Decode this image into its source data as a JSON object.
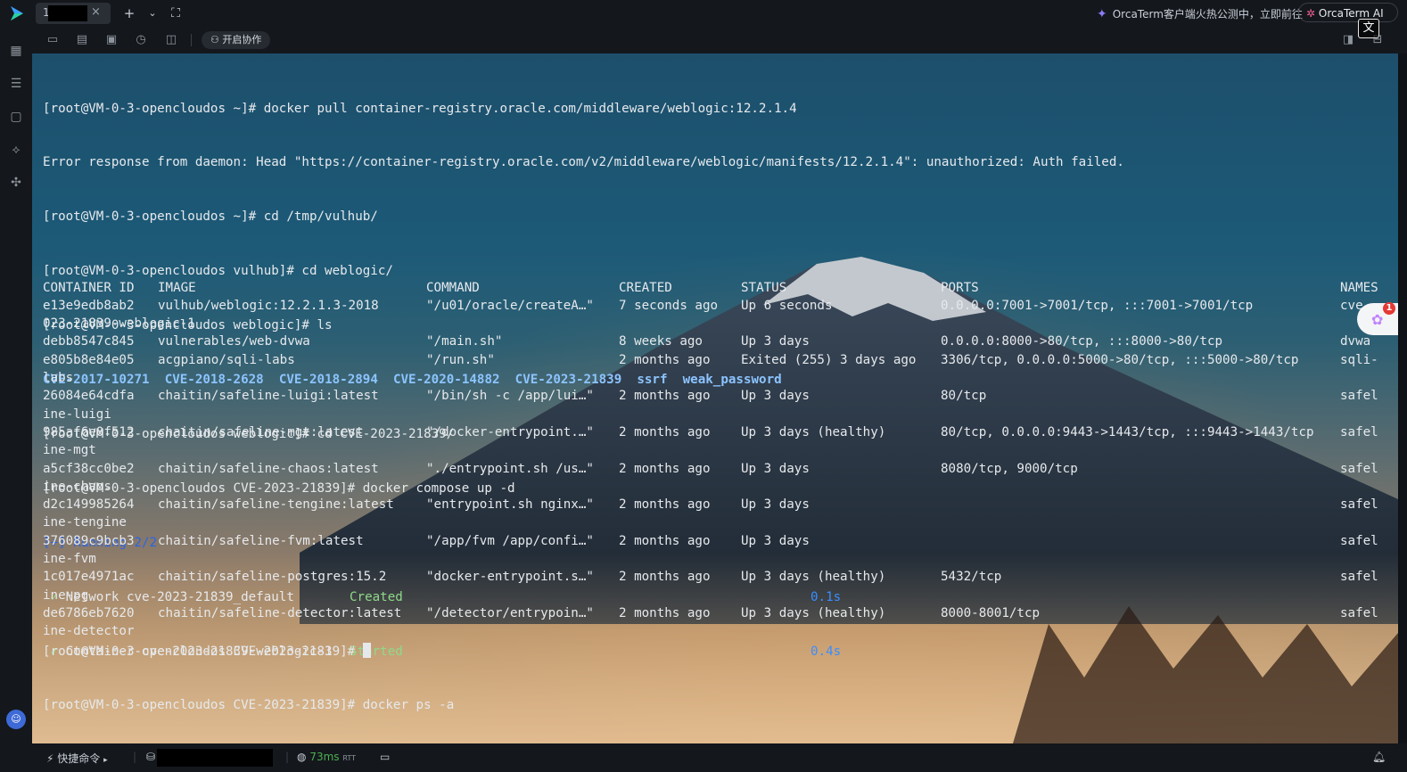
{
  "titlebar": {
    "tab_number": "1",
    "new_tab_symbol": "+",
    "promo_text": "OrcaTerm客户端火热公测中，立即前往",
    "ai_label": "OrcaTerm AI",
    "translate_symbol": "文"
  },
  "toolbar": {
    "collab_label": "开启协作"
  },
  "terminal": {
    "lines": [
      {
        "text": "[root@VM-0-3-opencloudos ~]# docker pull container-registry.oracle.com/middleware/weblogic:12.2.1.4"
      },
      {
        "text": "Error response from daemon: Head \"https://container-registry.oracle.com/v2/middleware/weblogic/manifests/12.2.1.4\": unauthorized: Auth failed."
      },
      {
        "text": "[root@VM-0-3-opencloudos ~]# cd /tmp/vulhub/"
      },
      {
        "text": "[root@VM-0-3-opencloudos vulhub]# cd weblogic/"
      },
      {
        "text": "[root@VM-0-3-opencloudos weblogic]# ls"
      }
    ],
    "ls_entries": [
      "CVE-2017-10271",
      "CVE-2018-2628",
      "CVE-2018-2894",
      "CVE-2020-14882",
      "CVE-2023-21839",
      "ssrf",
      "weak_password"
    ],
    "lines2": [
      {
        "text": "[root@VM-0-3-opencloudos weblogic]# cd CVE-2023-21839/"
      },
      {
        "text": "[root@VM-0-3-opencloudos CVE-2023-21839]# docker compose up -d"
      }
    ],
    "running_text": "[+] Running 2/2",
    "compose_items": [
      {
        "check": "✓",
        "name": "Network cve-2023-21839_default",
        "state": "Created",
        "time": "0.1s"
      },
      {
        "check": "✓",
        "name": "Container cve-2023-21839-weblogic-1",
        "state": "Started",
        "time": "0.4s"
      }
    ],
    "ps_command": "[root@VM-0-3-opencloudos CVE-2023-21839]# docker ps -a",
    "table_headers": [
      "CONTAINER ID",
      "IMAGE",
      "COMMAND",
      "CREATED",
      "STATUS",
      "PORTS",
      "NAMES"
    ],
    "rows": [
      {
        "id": "e13e9edb8ab2",
        "image": "vulhub/weblogic:12.2.1.3-2018",
        "command": "\"/u01/oracle/createA…\"",
        "created": "7 seconds ago",
        "status": "Up 6 seconds",
        "ports": "0.0.0.0:7001->7001/tcp, :::7001->7001/tcp",
        "name": "cve",
        "wrap": "023-21839-weblogic-1"
      },
      {
        "id": "debb8547c845",
        "image": "vulnerables/web-dvwa",
        "command": "\"/main.sh\"",
        "created": "8 weeks ago",
        "status": "Up 3 days",
        "ports": "0.0.0.0:8000->80/tcp, :::8000->80/tcp",
        "name": "dvwa",
        "wrap": ""
      },
      {
        "id": "e805b8e84e05",
        "image": "acgpiano/sqli-labs",
        "command": "\"/run.sh\"",
        "created": "2 months ago",
        "status": "Exited (255) 3 days ago",
        "ports": "3306/tcp, 0.0.0.0:5000->80/tcp, :::5000->80/tcp",
        "name": "sqli-",
        "wrap": "labs"
      },
      {
        "id": "26084e64cdfa",
        "image": "chaitin/safeline-luigi:latest",
        "command": "\"/bin/sh -c /app/lui…\"",
        "created": "2 months ago",
        "status": "Up 3 days",
        "ports": "80/tcp",
        "name": "safel",
        "wrap": "ine-luigi"
      },
      {
        "id": "985af6e0f512",
        "image": "chaitin/safeline-mgt:latest",
        "command": "\"/docker-entrypoint.…\"",
        "created": "2 months ago",
        "status": "Up 3 days (healthy)",
        "ports": "80/tcp, 0.0.0.0:9443->1443/tcp, :::9443->1443/tcp",
        "name": "safel",
        "wrap": "ine-mgt"
      },
      {
        "id": "a5cf38cc0be2",
        "image": "chaitin/safeline-chaos:latest",
        "command": "\"./entrypoint.sh /us…\"",
        "created": "2 months ago",
        "status": "Up 3 days",
        "ports": "8080/tcp, 9000/tcp",
        "name": "safel",
        "wrap": "ine-chaos"
      },
      {
        "id": "d2c149985264",
        "image": "chaitin/safeline-tengine:latest",
        "command": "\"entrypoint.sh nginx…\"",
        "created": "2 months ago",
        "status": "Up 3 days",
        "ports": "",
        "name": "safel",
        "wrap": "ine-tengine"
      },
      {
        "id": "376089c9bcb3",
        "image": "chaitin/safeline-fvm:latest",
        "command": "\"/app/fvm /app/confi…\"",
        "created": "2 months ago",
        "status": "Up 3 days",
        "ports": "",
        "name": "safel",
        "wrap": "ine-fvm"
      },
      {
        "id": "1c017e4971ac",
        "image": "chaitin/safeline-postgres:15.2",
        "command": "\"docker-entrypoint.s…\"",
        "created": "2 months ago",
        "status": "Up 3 days (healthy)",
        "ports": "5432/tcp",
        "name": "safel",
        "wrap": "ine-pg"
      },
      {
        "id": "de6786eb7620",
        "image": "chaitin/safeline-detector:latest",
        "command": "\"/detector/entrypoin…\"",
        "created": "2 months ago",
        "status": "Up 3 days (healthy)",
        "ports": "8000-8001/tcp",
        "name": "safel",
        "wrap": "ine-detector"
      }
    ],
    "prompt": "[root@VM-0-3-opencloudos CVE-2023-21839]# "
  },
  "statusbar": {
    "quick_cmd_label": "快捷命令",
    "latency": "73ms",
    "latency_unit": "RTT"
  },
  "float_badge": "1"
}
